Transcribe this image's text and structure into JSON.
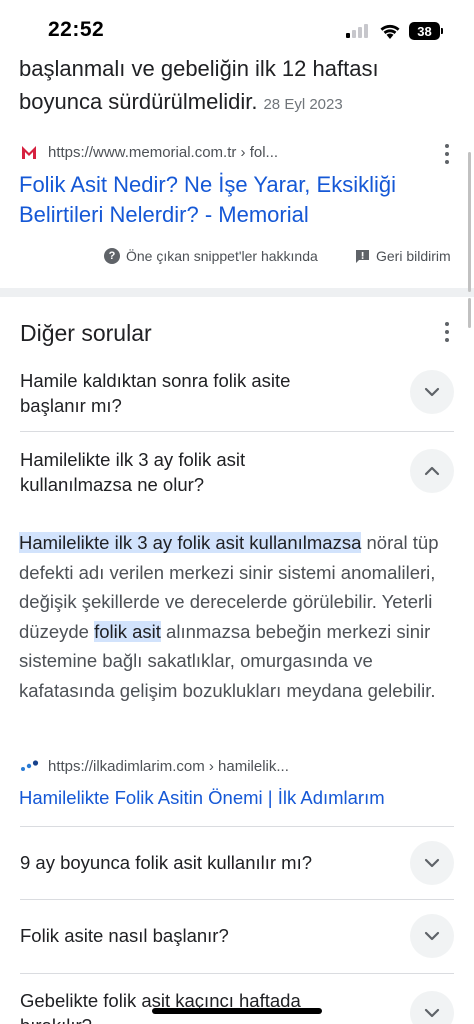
{
  "status_bar": {
    "time": "22:52",
    "battery": "38"
  },
  "top_snippet": {
    "text": "başlanmalı ve gebeliğin ilk 12 haftası boyunca sürdürülmelidir.",
    "date": "28 Eyl 2023"
  },
  "memorial_result": {
    "url": "https://www.memorial.com.tr › fol...",
    "title": "Folik Asit Nedir? Ne İşe Yarar, Eksikliği Belirtileri Nelerdir? - Memorial"
  },
  "feedback": {
    "about": "Öne çıkan snippet'ler hakkında",
    "report": "Geri bildirim"
  },
  "other_questions": {
    "heading": "Diğer sorular",
    "items": [
      {
        "question": "Hamile kaldıktan sonra folik asite başlanır mı?",
        "expanded": false
      },
      {
        "question": "Hamilelikte ilk 3 ay folik asit kullanılmazsa ne olur?",
        "expanded": true
      },
      {
        "question": "9 ay boyunca folik asit kullanılır mı?",
        "expanded": false
      },
      {
        "question": "Folik asite nasıl başlanır?",
        "expanded": false
      },
      {
        "question": "Gebelikte folik asit kaçıncı haftada bırakılır?",
        "expanded": false
      }
    ]
  },
  "answer": {
    "highlight_1": "Hamilelikte ilk 3 ay folik asit kullanılmazsa",
    "text_1": " nöral tüp defekti adı verilen merkezi sinir sistemi anomalileri, değişik şekillerde ve derecelerde görülebilir. Yeterli düzeyde ",
    "highlight_2": "folik asit",
    "text_2": " alınmazsa bebeğin merkezi sinir sistemine bağlı sakatlıklar, omurgasında ve kafatasında gelişim bozuklukları meydana gelebilir.",
    "source_url": "https://ilkadimlarim.com › hamilelik...",
    "source_title": "Hamilelikte Folik Asitin Önemi | İlk Adımlarım"
  },
  "colors": {
    "link": "#1558d6",
    "highlight": "#d2e3fc",
    "memorial_brand": "#d6213f"
  },
  "icons": {
    "memorial": "memorial-logo-icon",
    "ilkadimlarim": "ilkadimlarim-logo-icon",
    "help": "question-circle-icon",
    "feedback": "feedback-flag-icon",
    "more": "more-vert-icon",
    "expand": "chevron-down-icon",
    "collapse": "chevron-up-icon"
  }
}
